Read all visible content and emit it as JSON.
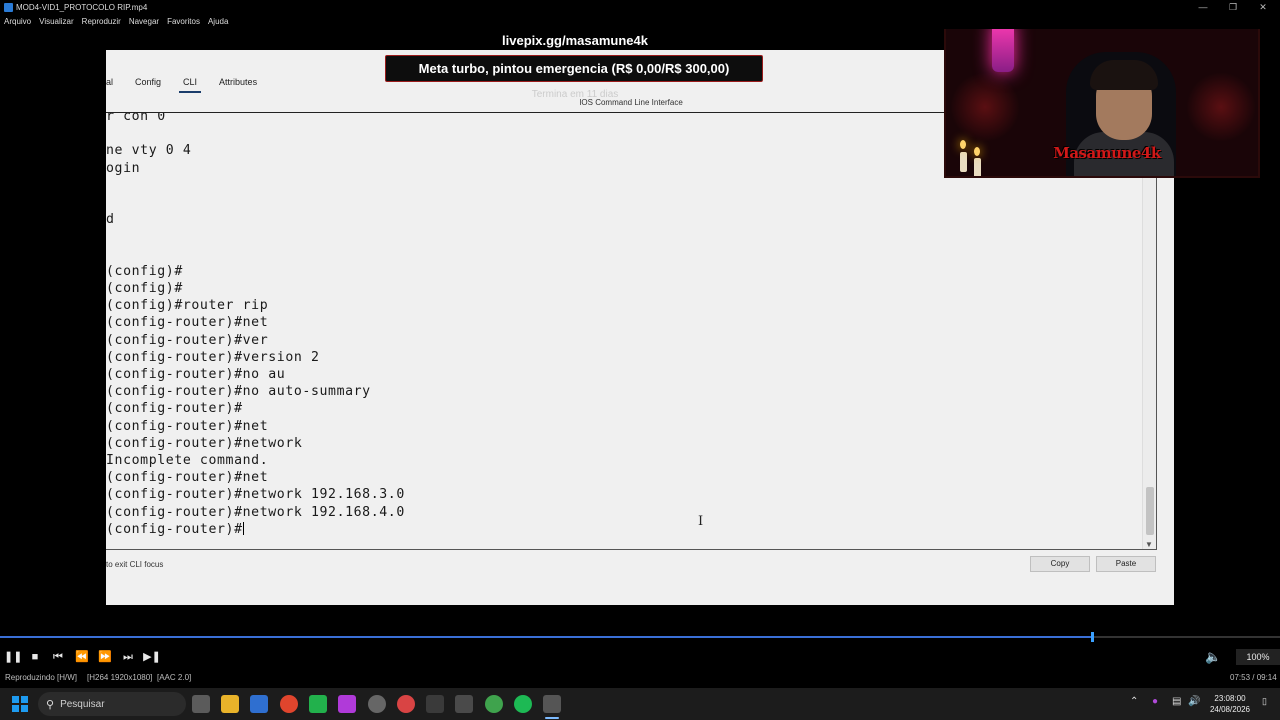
{
  "window": {
    "title": "MOD4-VID1_PROTOCOLO RIP.mp4"
  },
  "menu": [
    "Arquivo",
    "Visualizar",
    "Reproduzir",
    "Navegar",
    "Favoritos",
    "Ajuda"
  ],
  "stream": {
    "site": "livepix.gg/masamune4k",
    "goal": "Meta turbo, pintou emergencia (R$ 0,00/R$ 300,00)",
    "goal_sub": "Termina em 11 dias",
    "webcam_logo": "Masamune4k"
  },
  "packet_tracer": {
    "tabs": [
      {
        "label": "al",
        "active": false
      },
      {
        "label": "Config",
        "active": false
      },
      {
        "label": "CLI",
        "active": true
      },
      {
        "label": "Attributes",
        "active": false
      }
    ],
    "header": "IOS Command Line Interface",
    "cli_lines": [
      "r con 0",
      "",
      "ne vty 0 4",
      "ogin",
      "",
      "",
      "d",
      "",
      "",
      "(config)#",
      "(config)#",
      "(config)#router rip",
      "(config-router)#net",
      "(config-router)#ver",
      "(config-router)#version 2",
      "(config-router)#no au",
      "(config-router)#no auto-summary",
      "(config-router)#",
      "(config-router)#net",
      "(config-router)#network",
      "Incomplete command.",
      "(config-router)#net",
      "(config-router)#network 192.168.3.0",
      "(config-router)#network 192.168.4.0",
      "(config-router)#"
    ],
    "hint": "to exit CLI focus",
    "copy_label": "Copy",
    "paste_label": "Paste"
  },
  "player": {
    "progress": 0.853,
    "volume": "100%",
    "status_playing": "Reproduzindo [H/W]",
    "status_video": "[H264 1920x1080]",
    "status_audio": "[AAC 2.0]",
    "time": "07:53 / 09:14"
  },
  "taskbar": {
    "search_placeholder": "Pesquisar",
    "clock_time": "23:08:00",
    "clock_date": "24/08/2026"
  }
}
